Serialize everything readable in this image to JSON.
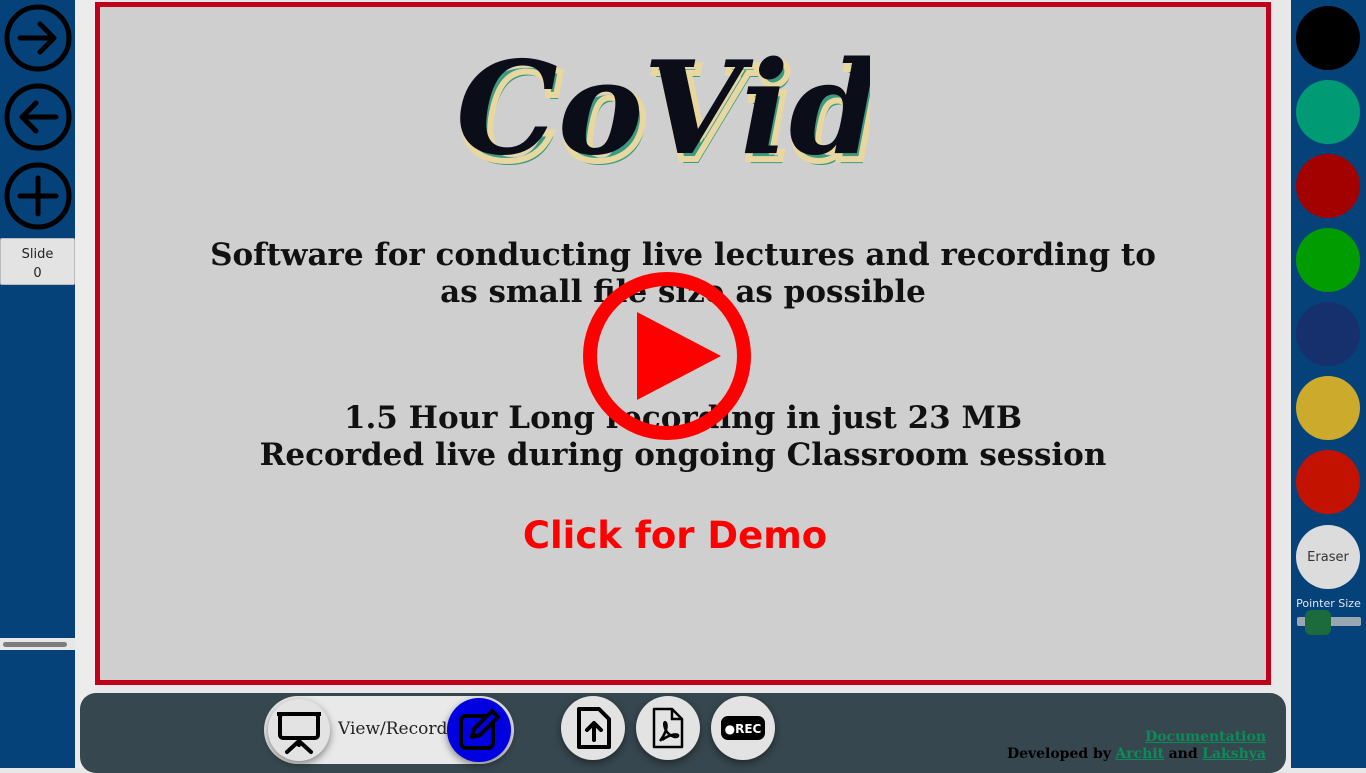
{
  "left_panel": {
    "slide_label": "Slide",
    "slide_number": "0"
  },
  "main": {
    "logo_text": "CoVid",
    "subtitle_line1": "Software for conducting live lectures and recording to",
    "subtitle_line2": "as small file size as possible",
    "detail_line1": "1.5 Hour Long recording in just 23 MB",
    "detail_line2": "Recorded live during ongoing Classroom session",
    "demo_link": "Click for Demo"
  },
  "colors": {
    "border_accent": "#c0001a",
    "side_bars": "#06427a",
    "palette": [
      "#000000",
      "#009b74",
      "#a30000",
      "#009c00",
      "#16306e",
      "#ccaa2c",
      "#c41200"
    ]
  },
  "right_panel": {
    "eraser_label": "Eraser",
    "pointer_size_label": "Pointer Size"
  },
  "toolbar": {
    "view_record_label": "View/Record",
    "rec_label": "●REC"
  },
  "footer": {
    "documentation_link": "Documentation",
    "developed_by": "Developed by",
    "author1": "Archit",
    "and_word": "and",
    "author2": "Lakshya"
  }
}
